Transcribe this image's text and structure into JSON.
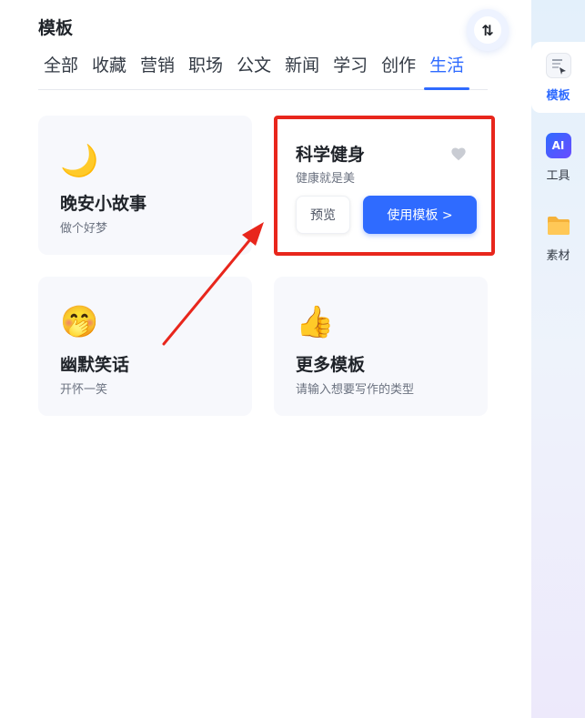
{
  "header": {
    "title": "模板",
    "sort_icon": "sort-arrows-icon",
    "sort_glyph": "⇅"
  },
  "tabs": [
    {
      "label": "全部"
    },
    {
      "label": "收藏"
    },
    {
      "label": "营销"
    },
    {
      "label": "职场"
    },
    {
      "label": "公文"
    },
    {
      "label": "新闻"
    },
    {
      "label": "学习"
    },
    {
      "label": "创作"
    },
    {
      "label": "生活",
      "active": true
    }
  ],
  "cards": {
    "goodnight": {
      "emoji": "🌙",
      "title": "晚安小故事",
      "subtitle": "做个好梦"
    },
    "fitness": {
      "title": "科学健身",
      "subtitle": "健康就是美",
      "preview_label": "预览",
      "use_label": "使用模板 >"
    },
    "jokes": {
      "emoji": "🤭",
      "title": "幽默笑话",
      "subtitle": "开怀一笑"
    },
    "more": {
      "emoji": "👍",
      "title": "更多模板",
      "subtitle": "请输入想要写作的类型"
    }
  },
  "sidebar": {
    "items": [
      {
        "label": "模板",
        "icon": "template-icon",
        "active": true
      },
      {
        "label": "工具",
        "icon": "ai-tool-icon",
        "icon_text": "AI"
      },
      {
        "label": "素材",
        "icon": "folder-icon"
      }
    ]
  },
  "colors": {
    "accent": "#2f6bff",
    "highlight_border": "#e8261c",
    "arrow": "#e8261c"
  }
}
